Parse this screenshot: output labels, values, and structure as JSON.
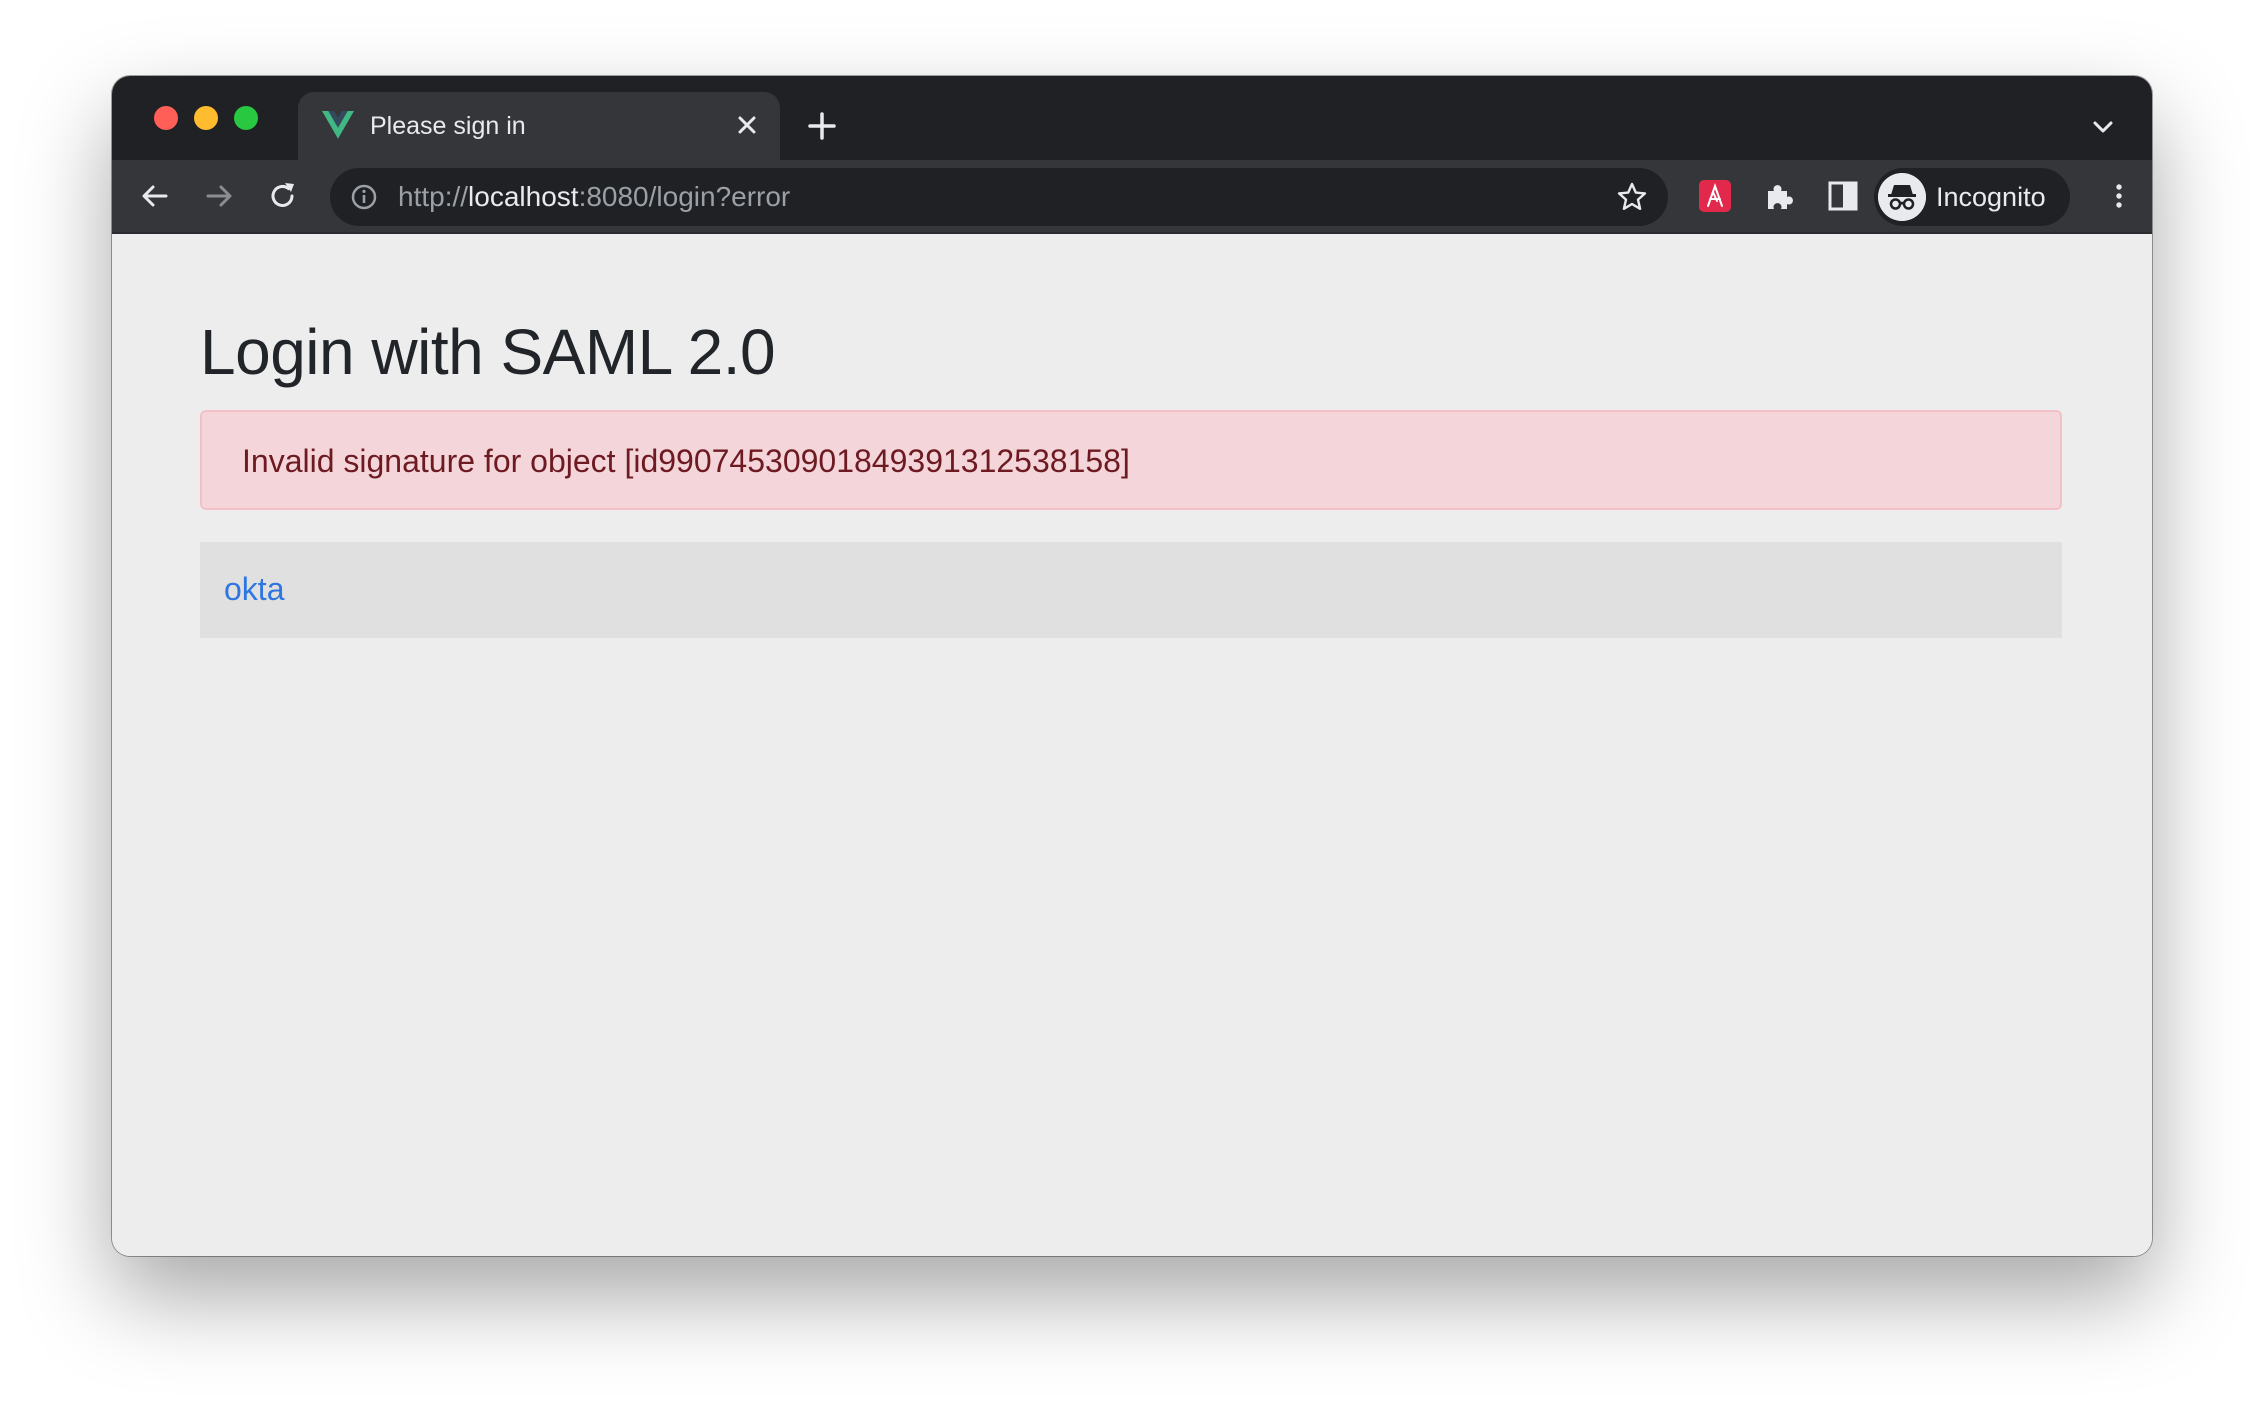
{
  "browser": {
    "tab": {
      "title": "Please sign in",
      "favicon": "vue-logo-icon"
    },
    "url": {
      "scheme": "http://",
      "host": "localhost",
      "rest": ":8080/login?error"
    },
    "profile": {
      "label": "Incognito"
    },
    "colors": {
      "frame": "#202124",
      "toolbar": "#35363a",
      "extension_accent": "#e2294b"
    }
  },
  "page": {
    "heading": "Login with SAML 2.0",
    "error_message": "Invalid signature for object [id99074530901849391312538158]",
    "providers": [
      {
        "label": "okta"
      }
    ],
    "colors": {
      "alert_bg": "#f4d6da",
      "alert_text": "#6e1a22",
      "link": "#2f76e0"
    }
  }
}
